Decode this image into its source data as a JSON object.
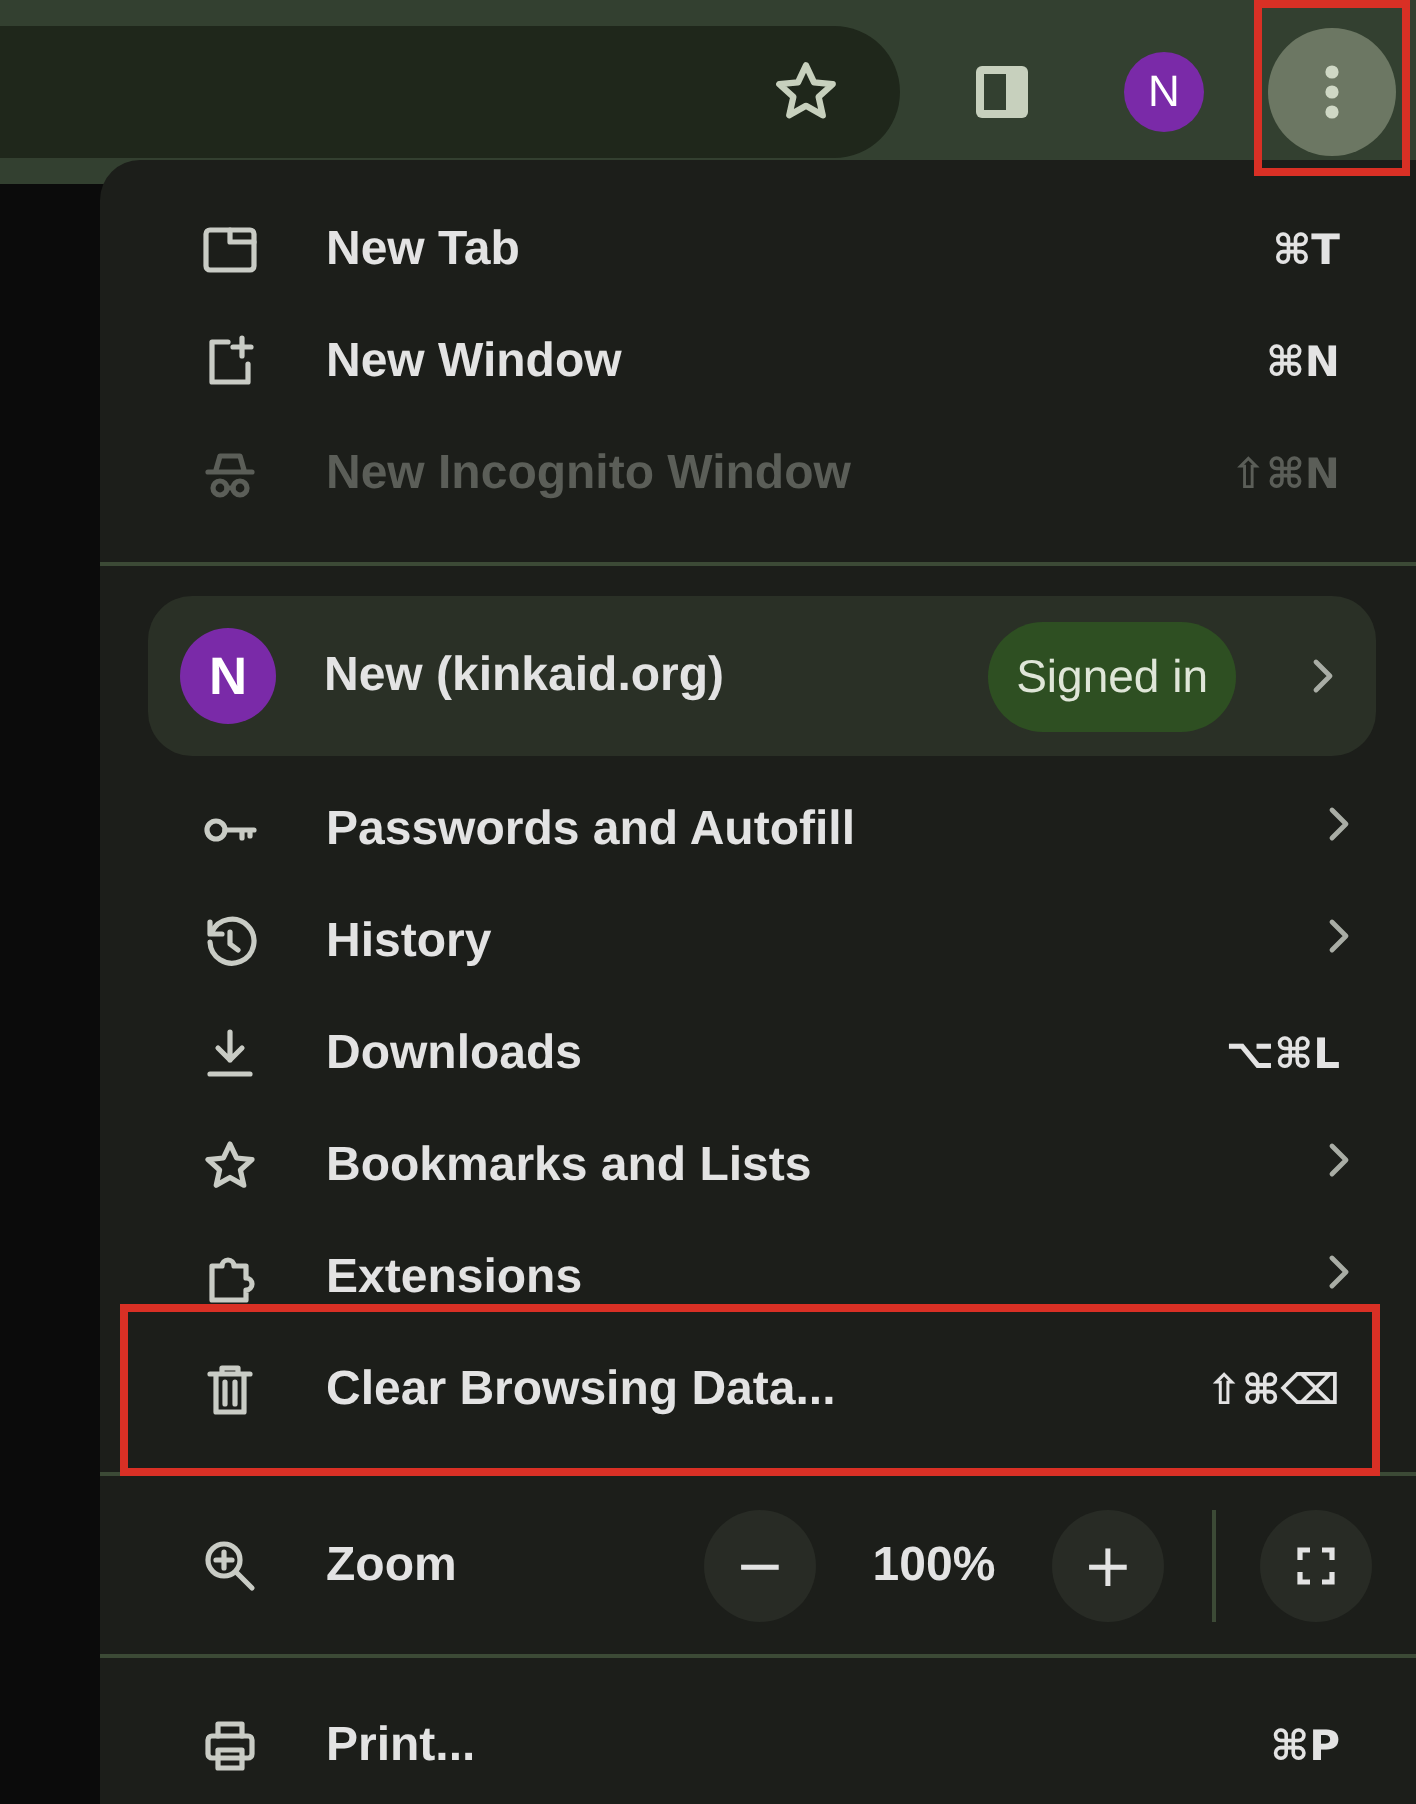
{
  "toolbar": {
    "avatar_letter": "N",
    "menu_button_highlighted": true
  },
  "menu": {
    "items": [
      {
        "kind": "item",
        "label": "New Tab",
        "shortcut": "⌘T",
        "submenu": false,
        "disabled": false,
        "highlighted": false
      },
      {
        "kind": "item",
        "label": "New Window",
        "shortcut": "⌘N",
        "submenu": false,
        "disabled": false,
        "highlighted": false
      },
      {
        "kind": "item",
        "label": "New Incognito Window",
        "shortcut": "⇧⌘N",
        "submenu": false,
        "disabled": true,
        "highlighted": false
      },
      {
        "kind": "divider"
      },
      {
        "kind": "profile",
        "avatar_letter": "N",
        "label": "New (kinkaid.org)",
        "status": "Signed in",
        "submenu": true
      },
      {
        "kind": "item",
        "label": "Passwords and Autofill",
        "submenu": true,
        "disabled": false,
        "highlighted": false
      },
      {
        "kind": "item",
        "label": "History",
        "submenu": true,
        "disabled": false,
        "highlighted": false
      },
      {
        "kind": "item",
        "label": "Downloads",
        "shortcut": "⌥⌘L",
        "submenu": false,
        "disabled": false,
        "highlighted": false
      },
      {
        "kind": "item",
        "label": "Bookmarks and Lists",
        "submenu": true,
        "disabled": false,
        "highlighted": false
      },
      {
        "kind": "item",
        "label": "Extensions",
        "submenu": true,
        "disabled": false,
        "highlighted": false
      },
      {
        "kind": "item",
        "label": "Clear Browsing Data...",
        "shortcut": "⇧⌘⌫",
        "submenu": false,
        "disabled": false,
        "highlighted": true
      },
      {
        "kind": "divider"
      },
      {
        "kind": "zoom",
        "label": "Zoom",
        "minus": "−",
        "value": "100%",
        "plus": "+"
      },
      {
        "kind": "divider"
      },
      {
        "kind": "item",
        "label": "Print...",
        "shortcut": "⌘P",
        "submenu": false,
        "disabled": false,
        "highlighted": false
      }
    ]
  }
}
